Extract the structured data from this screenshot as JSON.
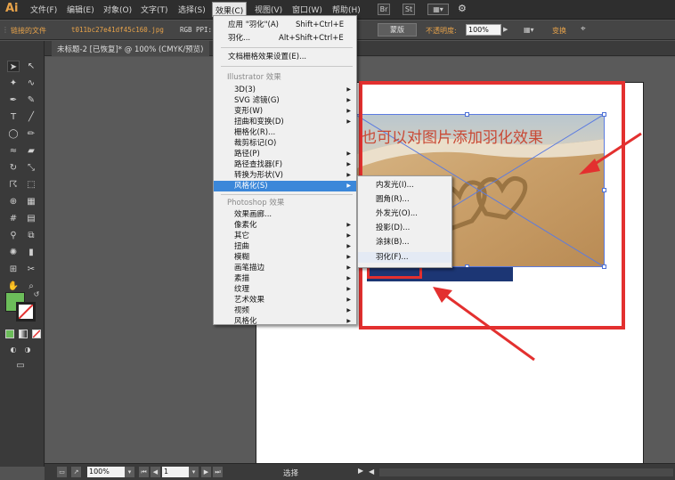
{
  "app": {
    "logo": "Ai"
  },
  "menubar": {
    "items": [
      "文件(F)",
      "编辑(E)",
      "对象(O)",
      "文字(T)",
      "选择(S)",
      "效果(C)",
      "视图(V)",
      "窗口(W)",
      "帮助(H)"
    ],
    "active": "效果(C)",
    "br_badge": "Br",
    "st_badge": "St"
  },
  "controlbar": {
    "linked_file": "链接的文件",
    "file_name": "t011bc27e41df45c160.jpg",
    "color_mode": "RGB",
    "ppi_label": "PPI: 3",
    "mask_button": "蒙版",
    "opacity_label": "不透明度:",
    "opacity_value": "100%",
    "transform_label": "变换"
  },
  "document_tab": {
    "title": "未标题-2 [已恢复]* @ 100% (CMYK/预览)"
  },
  "effect_menu": {
    "top_items": [
      {
        "label": "应用 \"羽化\"(A)",
        "shortcut": "Shift+Ctrl+E"
      },
      {
        "label": "羽化...",
        "shortcut": "Alt+Shift+Ctrl+E"
      }
    ],
    "raster_settings": "文档栅格效果设置(E)...",
    "illustrator_header": "Illustrator 效果",
    "illustrator_items": [
      "3D(3)",
      "SVG 滤镜(G)",
      "变形(W)",
      "扭曲和变换(D)",
      "栅格化(R)...",
      "裁剪标记(O)",
      "路径(P)",
      "路径查找器(F)",
      "转换为形状(V)",
      "风格化(S)"
    ],
    "photoshop_header": "Photoshop 效果",
    "photoshop_items": [
      "效果画廊...",
      "像素化",
      "其它",
      "扭曲",
      "模糊",
      "画笔描边",
      "素描",
      "纹理",
      "艺术效果",
      "视频",
      "风格化"
    ]
  },
  "stylize_submenu": {
    "items": [
      "内发光(I)...",
      "圆角(R)...",
      "外发光(O)...",
      "投影(D)...",
      "涂抹(B)...",
      "羽化(F)..."
    ]
  },
  "annotation": {
    "text": "也可以对图片添加羽化效果"
  },
  "statusbar": {
    "zoom": "100%",
    "page": "1",
    "mode": "选择"
  },
  "colors": {
    "highlight": "#3b87d9",
    "annotation_red": "#e3302f",
    "fill_green": "#6cbd5a",
    "navy": "#1c3674"
  }
}
